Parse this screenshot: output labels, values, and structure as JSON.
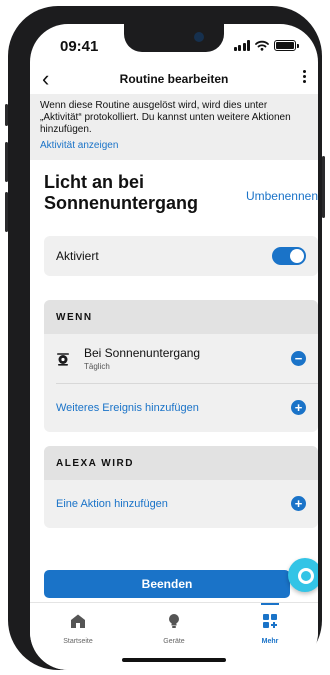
{
  "status": {
    "time": "09:41"
  },
  "nav": {
    "title": "Routine bearbeiten"
  },
  "info": {
    "text": "Wenn diese Routine ausgelöst wird, wird dies unter „Aktivität“ protokolliert. Du kannst unten weitere Aktionen hinzufügen.",
    "link": "Aktivität anzeigen"
  },
  "routine": {
    "title": "Licht an bei Sonnenuntergang",
    "rename": "Umbenennen"
  },
  "toggle": {
    "label": "Aktiviert",
    "enabled": true
  },
  "when": {
    "header": "WENN",
    "event": {
      "name": "Bei Sonnenuntergang",
      "frequency": "Täglich"
    },
    "add_label": "Weiteres Ereignis hinzufügen"
  },
  "alexa": {
    "header": "ALEXA WIRD",
    "add_label": "Eine Aktion hinzufügen"
  },
  "finish_label": "Beenden",
  "tabs": [
    {
      "label": "Startseite",
      "icon": "home-icon",
      "active": false
    },
    {
      "label": "Geräte",
      "icon": "lightbulb-icon",
      "active": false
    },
    {
      "label": "Mehr",
      "icon": "more-grid-icon",
      "active": true
    }
  ],
  "colors": {
    "accent": "#1a73c8",
    "alexa": "#33c4e6",
    "card": "#f0f0f0",
    "card_header": "#e2e2e2"
  }
}
